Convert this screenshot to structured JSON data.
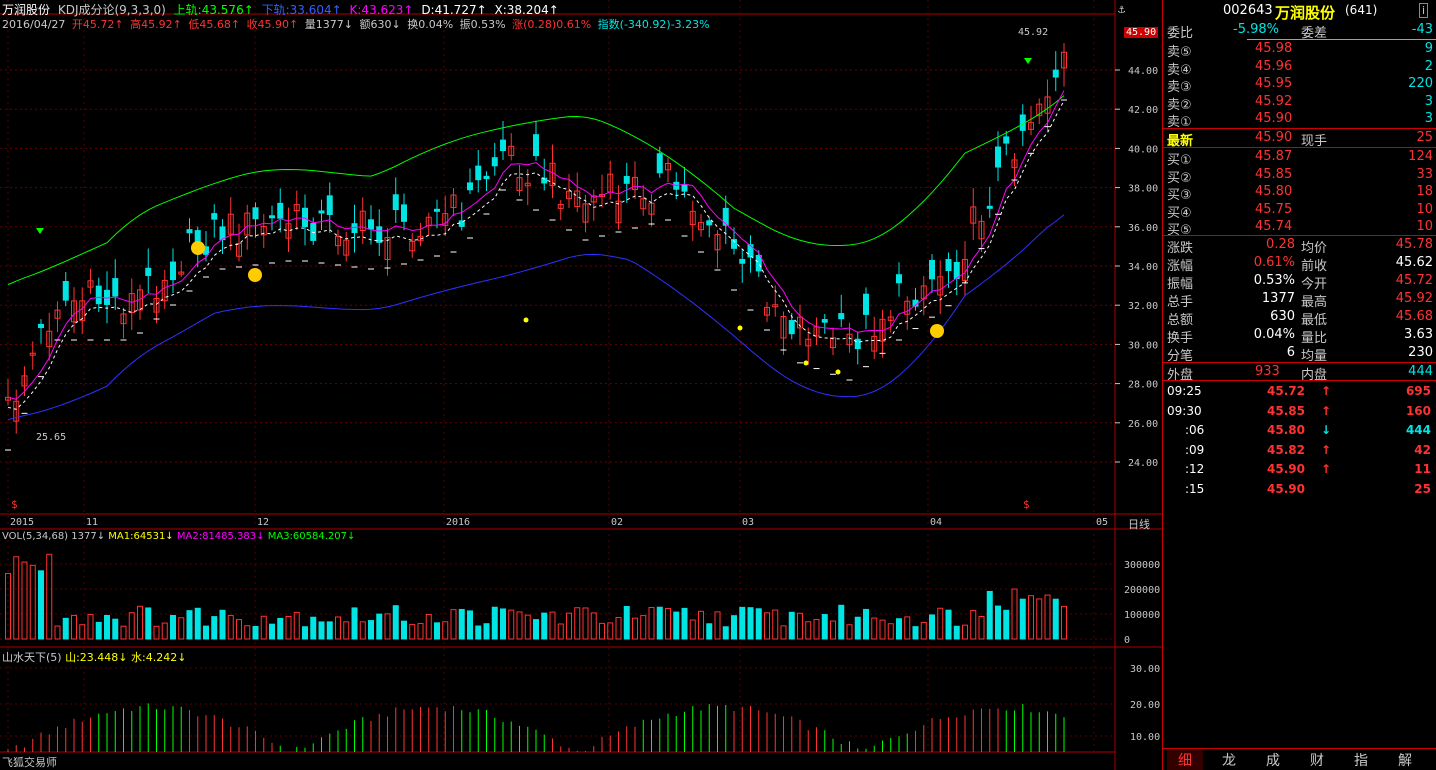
{
  "header": {
    "stock_name": "万润股份",
    "indicator": "KDJ成分论(9,3,3,0)",
    "upper": "上轨:43.576↑",
    "lower": "下轨:33.604↑",
    "k": "K:43.623↑",
    "d": "D:41.727↑",
    "x": "X:38.204↑",
    "date": "2016/04/27",
    "open": "开45.72↑",
    "high": "高45.92↑",
    "low": "低45.68↑",
    "close": "收45.90↑",
    "vol": "量1377↓",
    "amt": "额630↓",
    "turnover": "换0.04%",
    "amp": "振0.53%",
    "chg": "涨(0.28)0.61%",
    "index": "指数(-340.92)-3.23%"
  },
  "price_axis": [
    "44.00",
    "42.00",
    "40.00",
    "38.00",
    "36.00",
    "34.00",
    "32.00",
    "30.00",
    "28.00",
    "26.00",
    "24.00"
  ],
  "price_badge": "45.90",
  "annot_high": "45.92",
  "annot_low": "25.65",
  "time_axis": [
    "2015",
    "11",
    "12",
    "2016",
    "02",
    "03",
    "04",
    "05"
  ],
  "period": "日线",
  "vol_panel": {
    "title": "VOL(5,34,68)",
    "v": "1377↓",
    "ma1": "MA1:64531↓",
    "ma2": "MA2:81485.383↓",
    "ma3": "MA3:60584.207↓",
    "axis": [
      "300000",
      "200000",
      "100000",
      "0"
    ]
  },
  "sub_panel": {
    "title": "山水天下(5)",
    "mountain": "山:23.448↓",
    "water": "水:4.242↓",
    "axis": [
      "30.00",
      "20.00",
      "10.00"
    ]
  },
  "footer_label": "飞狐交易师",
  "quote": {
    "code": "002643",
    "name": "万润股份",
    "count": "(641)",
    "wb_label": "委比",
    "wb_val": "-5.98%",
    "wc_label": "委差",
    "wc_val": "-43",
    "asks": [
      {
        "label": "卖⑤",
        "price": "45.98",
        "vol": "9"
      },
      {
        "label": "卖④",
        "price": "45.96",
        "vol": "2"
      },
      {
        "label": "卖③",
        "price": "45.95",
        "vol": "220"
      },
      {
        "label": "卖②",
        "price": "45.92",
        "vol": "3"
      },
      {
        "label": "卖①",
        "price": "45.90",
        "vol": "3"
      }
    ],
    "last_label": "最新",
    "last_price": "45.90",
    "cur_label": "现手",
    "cur_val": "25",
    "bids": [
      {
        "label": "买①",
        "price": "45.87",
        "vol": "124"
      },
      {
        "label": "买②",
        "price": "45.85",
        "vol": "33"
      },
      {
        "label": "买③",
        "price": "45.80",
        "vol": "18"
      },
      {
        "label": "买④",
        "price": "45.75",
        "vol": "10"
      },
      {
        "label": "买⑤",
        "price": "45.74",
        "vol": "10"
      }
    ],
    "stats": [
      {
        "l1": "涨跌",
        "v1": "0.28",
        "c1": "red",
        "l2": "均价",
        "v2": "45.78",
        "c2": "red"
      },
      {
        "l1": "涨幅",
        "v1": "0.61%",
        "c1": "red",
        "l2": "前收",
        "v2": "45.62",
        "c2": "wht"
      },
      {
        "l1": "振幅",
        "v1": "0.53%",
        "c1": "wht",
        "l2": "今开",
        "v2": "45.72",
        "c2": "red"
      },
      {
        "l1": "总手",
        "v1": "1377",
        "c1": "wht",
        "l2": "最高",
        "v2": "45.92",
        "c2": "red"
      },
      {
        "l1": "总额",
        "v1": "630",
        "c1": "wht",
        "l2": "最低",
        "v2": "45.68",
        "c2": "red"
      },
      {
        "l1": "换手",
        "v1": "0.04%",
        "c1": "wht",
        "l2": "量比",
        "v2": "3.63",
        "c2": "wht"
      },
      {
        "l1": "分笔",
        "v1": "6",
        "c1": "wht",
        "l2": "均量",
        "v2": "230",
        "c2": "wht"
      }
    ],
    "outer_label": "外盘",
    "outer_val": "933",
    "inner_label": "内盘",
    "inner_val": "444",
    "ticks": [
      {
        "time": "09:25",
        "price": "45.72",
        "dir": "↑",
        "vol": "695"
      },
      {
        "time": "09:30",
        "price": "45.85",
        "dir": "↑",
        "vol": "160"
      },
      {
        "time": ":06",
        "price": "45.80",
        "dir": "↓",
        "vol": "444"
      },
      {
        "time": ":09",
        "price": "45.82",
        "dir": "↑",
        "vol": "42"
      },
      {
        "time": ":12",
        "price": "45.90",
        "dir": "↑",
        "vol": "11"
      },
      {
        "time": ":15",
        "price": "45.90",
        "dir": "",
        "vol": "25"
      }
    ],
    "tabs": [
      "细",
      "龙",
      "成",
      "财",
      "指",
      "解"
    ]
  },
  "colors": {
    "up": "#ff3232",
    "down": "#00e4e4",
    "upper_band": "#00ff00",
    "lower_band": "#3030ff",
    "k_line": "#ff00ff",
    "frame": "#b00000"
  }
}
